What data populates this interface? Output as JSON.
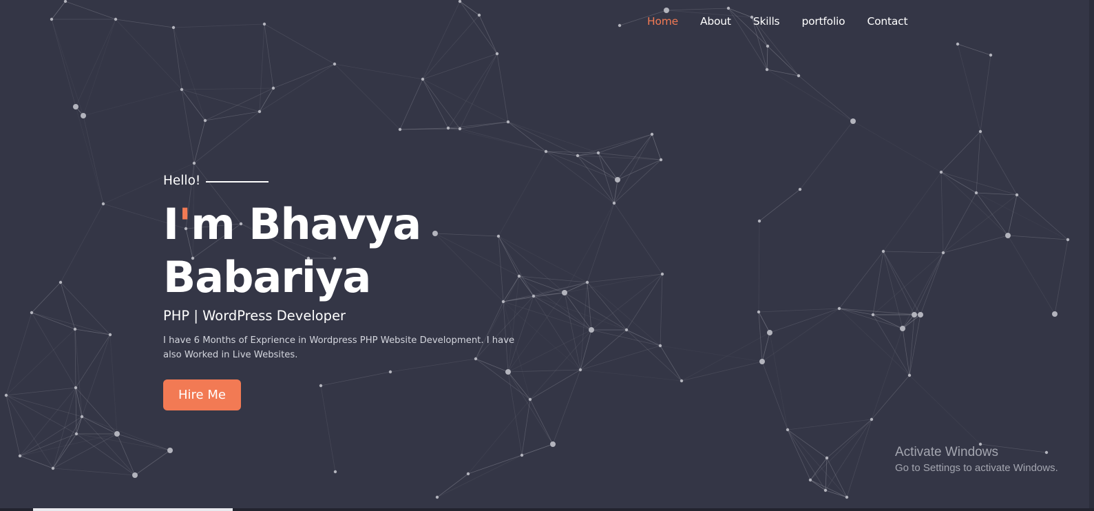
{
  "colors": {
    "background": "#343646",
    "accent": "#f27a54",
    "text": "#ffffff",
    "particle": "#9a9ba6"
  },
  "nav": {
    "items": [
      {
        "label": "Home",
        "active": true
      },
      {
        "label": "About",
        "active": false
      },
      {
        "label": "Skills",
        "active": false
      },
      {
        "label": "portfolio",
        "active": false
      },
      {
        "label": "Contact",
        "active": false
      }
    ]
  },
  "hero": {
    "greeting": "Hello!",
    "name_pre": "I",
    "name_apostrophe": "'",
    "name_post": "m Bhavya",
    "name_line2": "Babariya",
    "role": "PHP | WordPress Developer",
    "description": "I have 6 Months of Exprience in Wordpress PHP Website Development. I have also Worked in Live Websites.",
    "cta_label": "Hire Me"
  },
  "watermark": {
    "title": "Activate Windows",
    "subtitle": "Go to Settings to activate Windows."
  }
}
